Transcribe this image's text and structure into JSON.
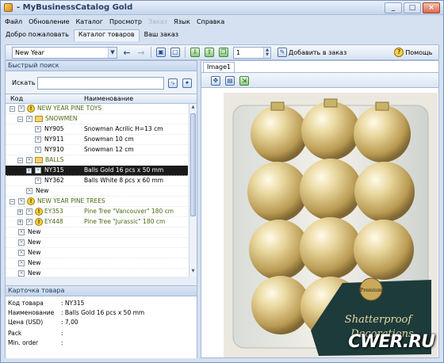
{
  "window": {
    "title": " - MyBusinessCatalog Gold",
    "controls": [
      "_",
      "□",
      "×"
    ]
  },
  "menu": [
    "Файл",
    "Обновление",
    "Каталог",
    "Просмотр",
    "Заказ",
    "Язык",
    "Справка"
  ],
  "tabs": [
    "Добро пожаловать",
    "Каталог товаров",
    "Ваш заказ"
  ],
  "toolbar": {
    "catalog_select": "New Year",
    "quantity": "1",
    "add_to_order": "Добавить в заказ",
    "help": "Помощь"
  },
  "quick_search": {
    "header": "Быстрый поиск",
    "label": "Искать",
    "value": ""
  },
  "tree": {
    "col_code": "Код",
    "col_name": "Наименование",
    "rows": [
      {
        "code": "NEW YEAR PINE TOYS",
        "name": ""
      },
      {
        "code": "SNOWMEN",
        "name": ""
      },
      {
        "code": "NY905",
        "name": "Snowman Acrilic H=13 cm"
      },
      {
        "code": "NY911",
        "name": "Snowman 10 cm"
      },
      {
        "code": "NY910",
        "name": "Snowman 12 cm"
      },
      {
        "code": "BALLS",
        "name": ""
      },
      {
        "code": "NY315",
        "name": "Balls Gold 16 pcs x 50 mm"
      },
      {
        "code": "NY362",
        "name": "Balls White  8 pcs x 60 mm"
      },
      {
        "code": "New",
        "name": ""
      },
      {
        "code": "NEW YEAR PINE TREES",
        "name": ""
      },
      {
        "code": "EY353",
        "name": "Pine Tree \"Vancouver\" 180 cm"
      },
      {
        "code": "EY448",
        "name": "Pine Tree \"Jurassic\" 180 cm"
      },
      {
        "code": "New",
        "name": ""
      },
      {
        "code": "New",
        "name": ""
      },
      {
        "code": "New",
        "name": ""
      },
      {
        "code": "New",
        "name": ""
      },
      {
        "code": "New",
        "name": ""
      },
      {
        "code": "New",
        "name": ""
      }
    ]
  },
  "card": {
    "header": "Карточка товара",
    "fields": [
      {
        "label": "Код товара",
        "value": ": NY315"
      },
      {
        "label": "Наименование",
        "value": ": Balls Gold 16 pcs x 50 mm"
      },
      {
        "label": "Цена (USD)",
        "value": ": 7,00"
      },
      {
        "label": "Pack",
        "value": ":"
      },
      {
        "label": "Min. order",
        "value": ":"
      }
    ]
  },
  "image_panel": {
    "tab": "Image1",
    "label_premium": "Premium",
    "label_brand1": "Shatterproof",
    "label_brand2": "Decorations"
  },
  "watermark": "CWER.RU",
  "colors": {
    "selection": "#1a1a1a",
    "gold": "#d8be78",
    "group_text": "#4a6b13"
  }
}
